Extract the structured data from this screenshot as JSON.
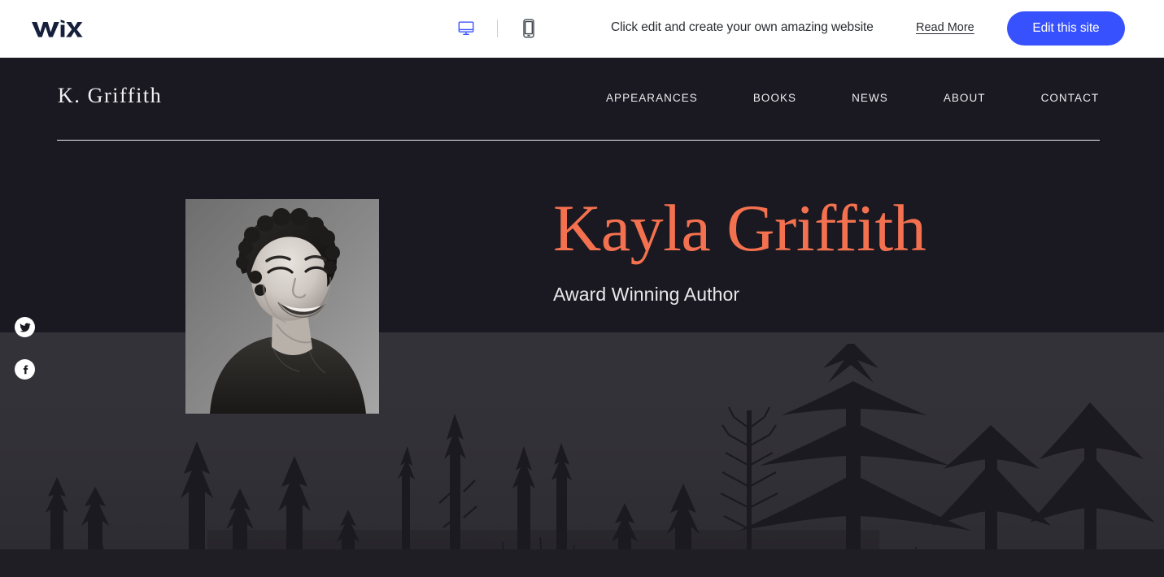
{
  "wix_bar": {
    "logo_icon": "wix-logo",
    "devices": [
      {
        "icon": "desktop-view-icon",
        "label": "Desktop view",
        "active": true
      },
      {
        "icon": "mobile-view-icon",
        "label": "Mobile view",
        "active": false
      }
    ],
    "message": "Click edit and create your own amazing website",
    "read_more_label": "Read More",
    "edit_button_label": "Edit this site",
    "accent_color": "#3751FF"
  },
  "site": {
    "brand": "K. Griffith",
    "nav": [
      {
        "label": "APPEARANCES"
      },
      {
        "label": "BOOKS"
      },
      {
        "label": "NEWS"
      },
      {
        "label": "ABOUT"
      },
      {
        "label": "CONTACT"
      }
    ],
    "hero": {
      "title": "Kayla Griffith",
      "subtitle": "Award Winning Author",
      "title_color": "#F4714F",
      "portrait_alt": "Black and white portrait of smiling woman with short curly hair",
      "background_alt": "Dark forest tree silhouettes at dusk"
    },
    "social": [
      {
        "icon": "twitter-icon",
        "label": "Twitter"
      },
      {
        "icon": "facebook-icon",
        "label": "Facebook"
      }
    ],
    "colors": {
      "header_background": "#1A1821",
      "scenery_background": "#2E2D35",
      "nav_text": "#EDEDEF"
    }
  }
}
